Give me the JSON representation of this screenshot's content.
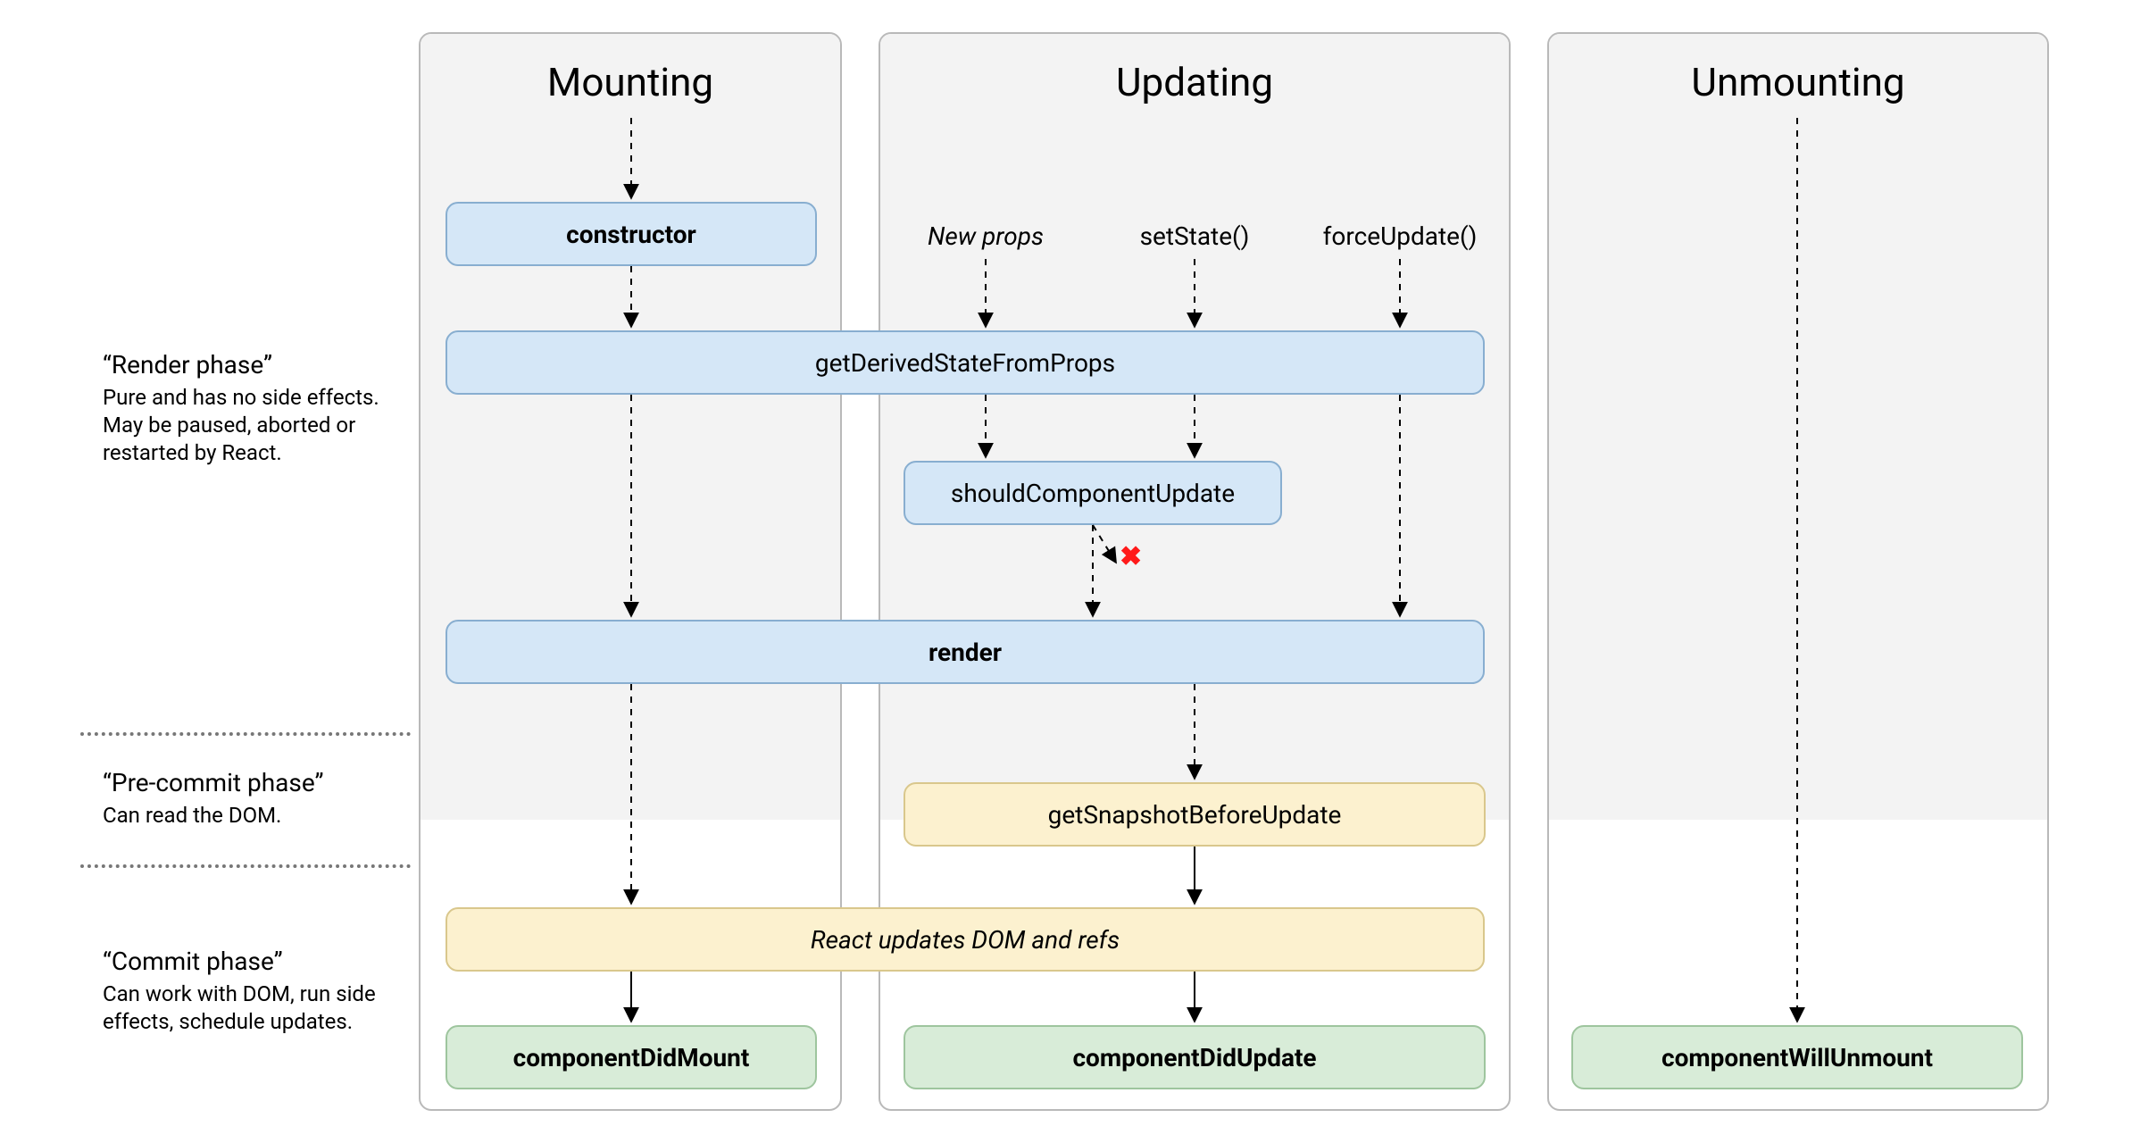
{
  "columns": {
    "mounting": "Mounting",
    "updating": "Updating",
    "unmounting": "Unmounting"
  },
  "phases": {
    "render": {
      "title": "“Render phase”",
      "desc": "Pure and has no side effects. May be paused, aborted or restarted by React."
    },
    "precommit": {
      "title": "“Pre-commit phase”",
      "desc": "Can read the DOM."
    },
    "commit": {
      "title": "“Commit phase”",
      "desc": "Can work with DOM, run side effects, schedule updates."
    }
  },
  "triggers": {
    "newProps": "New props",
    "setState": "setState()",
    "forceUpdate": "forceUpdate()"
  },
  "boxes": {
    "constructor": "constructor",
    "getDerivedStateFromProps": "getDerivedStateFromProps",
    "shouldComponentUpdate": "shouldComponentUpdate",
    "render": "render",
    "getSnapshotBeforeUpdate": "getSnapshotBeforeUpdate",
    "reactUpdates": "React updates DOM and refs",
    "componentDidMount": "componentDidMount",
    "componentDidUpdate": "componentDidUpdate",
    "componentWillUnmount": "componentWillUnmount"
  },
  "marks": {
    "x": "✖"
  }
}
